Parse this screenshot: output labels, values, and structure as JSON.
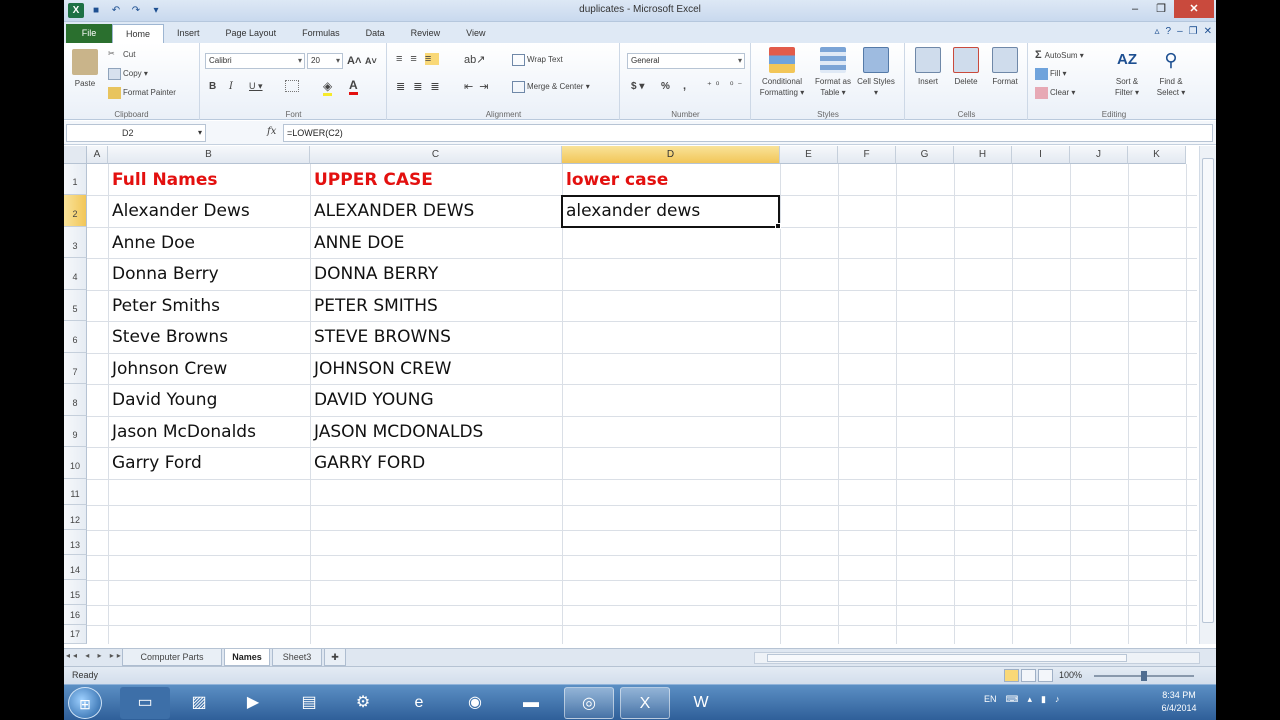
{
  "window": {
    "title": "duplicates - Microsoft Excel"
  },
  "ribbon_tabs": [
    "File",
    "Home",
    "Insert",
    "Page Layout",
    "Formulas",
    "Data",
    "Review",
    "View"
  ],
  "active_tab": "Home",
  "ribbon": {
    "clipboard": {
      "label": "Clipboard",
      "paste": "Paste",
      "cut": "Cut",
      "copy": "Copy ▾",
      "format_painter": "Format Painter"
    },
    "font": {
      "label": "Font",
      "font_name": "Calibri",
      "font_size": "20",
      "bold": "B",
      "italic": "I",
      "underline": "U ▾"
    },
    "alignment": {
      "label": "Alignment",
      "wrap_text": "Wrap Text",
      "merge_center": "Merge & Center ▾"
    },
    "number": {
      "label": "Number",
      "format": "General",
      "currency": "$ ▾",
      "percent": "%",
      "comma": ","
    },
    "styles": {
      "label": "Styles",
      "conditional": "Conditional Formatting ▾",
      "format_table": "Format as Table ▾",
      "cell_styles": "Cell Styles ▾"
    },
    "cells": {
      "label": "Cells",
      "insert": "Insert",
      "delete": "Delete",
      "format": "Format"
    },
    "editing": {
      "label": "Editing",
      "autosum": "AutoSum ▾",
      "fill": "Fill ▾",
      "clear": "Clear ▾",
      "sort_filter": "Sort & Filter ▾",
      "find_select": "Find & Select ▾"
    }
  },
  "formula_bar": {
    "name_box": "D2",
    "fx": "fx",
    "formula": "=LOWER(C2)"
  },
  "columns": [
    "A",
    "B",
    "C",
    "D",
    "E",
    "F",
    "G",
    "H",
    "I",
    "J",
    "K"
  ],
  "selected_column": "D",
  "rows": [
    "1",
    "2",
    "3",
    "4",
    "5",
    "6",
    "7",
    "8",
    "9",
    "10",
    "11",
    "12",
    "13",
    "14",
    "15",
    "16",
    "17"
  ],
  "selected_row": "2",
  "headers": {
    "full_names": "Full Names",
    "upper_case": "UPPER CASE",
    "lower_case": "lower case"
  },
  "full_names": [
    "Alexander Dews",
    "Anne Doe",
    "Donna Berry",
    "Peter Smiths",
    "Steve Browns",
    "Johnson Crew",
    "David Young",
    "Jason McDonalds",
    "Garry Ford"
  ],
  "upper_names": [
    "ALEXANDER DEWS",
    "ANNE DOE",
    "DONNA BERRY",
    "PETER SMITHS",
    "STEVE BROWNS",
    "JOHNSON CREW",
    "DAVID YOUNG",
    "JASON MCDONALDS",
    "GARRY FORD"
  ],
  "lower_names": [
    "alexander dews"
  ],
  "sheets": [
    "Computer Parts",
    "Names",
    "Sheet3"
  ],
  "active_sheet": "Names",
  "status": {
    "ready": "Ready",
    "zoom": "100%"
  },
  "taskbar": {
    "lang": "EN",
    "time": "8:34 PM",
    "date": "6/4/2014"
  }
}
